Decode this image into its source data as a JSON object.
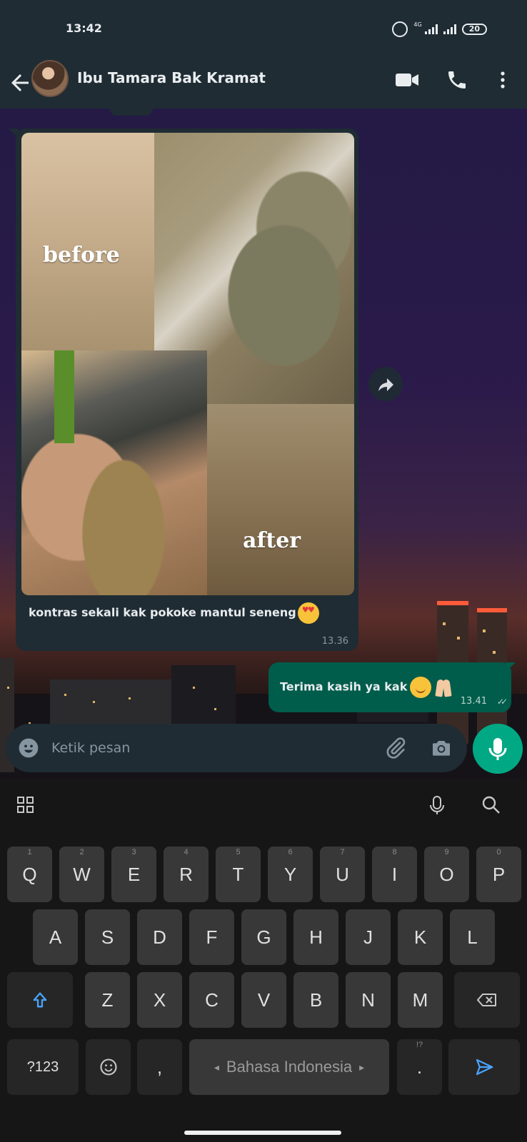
{
  "status_bar": {
    "time": "13:42",
    "network": "4G",
    "battery": "20"
  },
  "header": {
    "contact_name": "Ibu Tamara Bak Kramat"
  },
  "messages": {
    "incoming": {
      "collage_label_before": "before",
      "collage_label_after": "after",
      "text": "kontras sekali kak pokoke mantul seneng",
      "time": "13.36"
    },
    "outgoing": {
      "text": "Terima kasih ya kak",
      "time": "13.41"
    }
  },
  "input": {
    "placeholder": "Ketik pesan"
  },
  "keyboard": {
    "row1": [
      {
        "num": "1",
        "key": "Q"
      },
      {
        "num": "2",
        "key": "W"
      },
      {
        "num": "3",
        "key": "E"
      },
      {
        "num": "4",
        "key": "R"
      },
      {
        "num": "5",
        "key": "T"
      },
      {
        "num": "6",
        "key": "Y"
      },
      {
        "num": "7",
        "key": "U"
      },
      {
        "num": "8",
        "key": "I"
      },
      {
        "num": "9",
        "key": "O"
      },
      {
        "num": "0",
        "key": "P"
      }
    ],
    "row2": [
      "A",
      "S",
      "D",
      "F",
      "G",
      "H",
      "J",
      "K",
      "L"
    ],
    "row3": [
      "Z",
      "X",
      "C",
      "V",
      "B",
      "N",
      "M"
    ],
    "bottom": {
      "symbols": "?123",
      "comma": ",",
      "space": "Bahasa Indonesia",
      "period": ".",
      "period_hint": "!?"
    }
  },
  "colors": {
    "header_bg": "#1f2c34",
    "outgoing_bubble": "#005c4b",
    "incoming_bubble": "#1f2c34",
    "accent": "#00a884"
  },
  "icons": [
    "back-arrow-icon",
    "video-call-icon",
    "phone-icon",
    "more-options-icon",
    "forward-icon",
    "emoji-icon",
    "attach-icon",
    "camera-icon",
    "mic-icon",
    "grid-icon",
    "keyboard-mic-icon",
    "search-icon",
    "shift-icon",
    "backspace-icon",
    "send-icon"
  ]
}
